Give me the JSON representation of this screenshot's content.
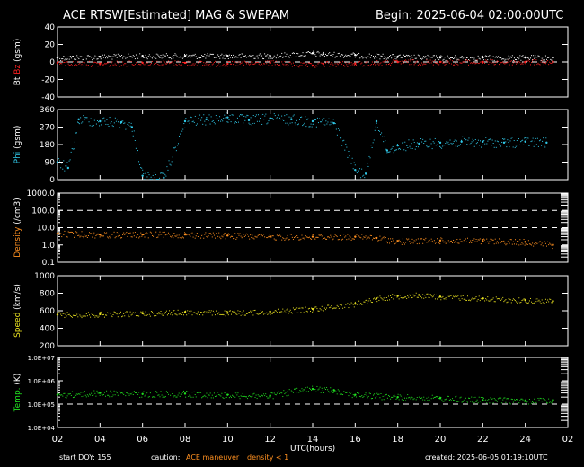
{
  "header": {
    "title": "ACE RTSW[Estimated] MAG & SWEPAM",
    "begin": "Begin: 2025-06-04 02:00:00UTC"
  },
  "footer": {
    "start": "start DOY: 155",
    "caution": "caution:",
    "maneuver": "ACE maneuver",
    "density": "density < 1",
    "created": "created: 2025-06-05 01:19:10UTC"
  },
  "colors": {
    "bt": "#ffffff",
    "bz": "#ff2020",
    "phi": "#30c8e8",
    "density": "#ff9020",
    "speed": "#e8e020",
    "temp": "#20e020",
    "axis": "#ffffff"
  },
  "chart_data": [
    {
      "type": "scatter",
      "panel": "mag",
      "ylabel_parts": [
        "Bt",
        "Bz",
        "(gsm)"
      ],
      "ylim": [
        -40,
        40
      ],
      "yticks": [
        "40",
        "20",
        "0",
        "-20",
        "-40"
      ],
      "dashed_lines": [
        0
      ],
      "x": [
        2,
        4,
        6,
        8,
        10,
        12,
        14,
        14.5,
        16,
        18,
        20,
        22,
        24,
        25.3
      ],
      "series": [
        {
          "name": "Bt",
          "values": [
            5,
            6,
            7,
            7,
            7,
            7,
            10,
            9,
            8,
            6,
            5,
            5,
            5,
            5
          ]
        },
        {
          "name": "Bz",
          "values": [
            -1,
            -2,
            -1,
            -1,
            -2,
            -1,
            -4,
            -2,
            -2,
            0,
            0,
            0,
            0,
            0
          ]
        }
      ]
    },
    {
      "type": "scatter",
      "panel": "phi",
      "ylabel_parts": [
        "Phi",
        "(gsm)"
      ],
      "ylim": [
        0,
        360
      ],
      "yticks": [
        "360",
        "270",
        "180",
        "90",
        "0"
      ],
      "x": [
        2,
        2.5,
        3,
        4,
        5,
        5.5,
        6,
        7,
        8,
        9,
        10,
        11,
        12,
        13,
        14,
        15,
        16,
        16.5,
        17,
        17.5,
        18,
        19,
        20,
        21,
        22,
        23,
        24,
        25
      ],
      "series": [
        {
          "name": "Phi",
          "values": [
            90,
            60,
            310,
            300,
            295,
            270,
            20,
            10,
            300,
            310,
            320,
            305,
            315,
            310,
            300,
            290,
            50,
            30,
            300,
            150,
            175,
            185,
            190,
            195,
            195,
            190,
            195,
            190
          ]
        }
      ]
    },
    {
      "type": "scatter",
      "panel": "density",
      "ylabel_parts": [
        "Density",
        "(/cm3)"
      ],
      "yscale": "log",
      "ylim": [
        0.1,
        1000
      ],
      "yticks": [
        "1000.0",
        "100.0",
        "10.0",
        "1.0",
        "0.1"
      ],
      "dashed_lines": [
        100,
        10
      ],
      "x": [
        2,
        4,
        6,
        8,
        10,
        12,
        14,
        16,
        17,
        18,
        20,
        22,
        24,
        25.3
      ],
      "series": [
        {
          "name": "Density",
          "values": [
            4.5,
            4,
            4,
            4,
            3.5,
            3,
            3,
            3,
            2.5,
            1.6,
            1.8,
            1.7,
            1.5,
            1.0
          ]
        }
      ]
    },
    {
      "type": "scatter",
      "panel": "speed",
      "ylabel_parts": [
        "Speed",
        "(km/s)"
      ],
      "ylim": [
        200,
        1000
      ],
      "yticks": [
        "1000",
        "800",
        "600",
        "400",
        "200"
      ],
      "x": [
        2,
        4,
        6,
        8,
        10,
        12,
        14,
        16,
        17,
        18,
        19,
        20,
        22,
        24,
        25.3
      ],
      "series": [
        {
          "name": "Speed",
          "values": [
            555,
            560,
            570,
            585,
            575,
            590,
            620,
            680,
            740,
            770,
            780,
            760,
            740,
            720,
            710
          ]
        }
      ]
    },
    {
      "type": "scatter",
      "panel": "temp",
      "ylabel_parts": [
        "Temp.",
        "(K)"
      ],
      "yscale": "log",
      "ylim": [
        10000,
        10000000
      ],
      "yticks": [
        "1.0E+07",
        "1.0E+06",
        "1.0E+05",
        "1.0E+04"
      ],
      "dashed_lines": [
        100000
      ],
      "x": [
        2,
        4,
        6,
        8,
        10,
        12,
        14,
        15,
        16,
        18,
        20,
        22,
        24,
        25.3
      ],
      "series": [
        {
          "name": "Temp",
          "values": [
            250000,
            300000,
            270000,
            280000,
            250000,
            230000,
            450000,
            400000,
            250000,
            200000,
            180000,
            150000,
            140000,
            150000
          ]
        }
      ]
    }
  ],
  "x_axis": {
    "xlim": [
      2,
      26
    ],
    "ticks": [
      "02",
      "04",
      "06",
      "08",
      "10",
      "12",
      "14",
      "16",
      "18",
      "20",
      "22",
      "24",
      "02"
    ],
    "label": "UTC(hours)"
  }
}
